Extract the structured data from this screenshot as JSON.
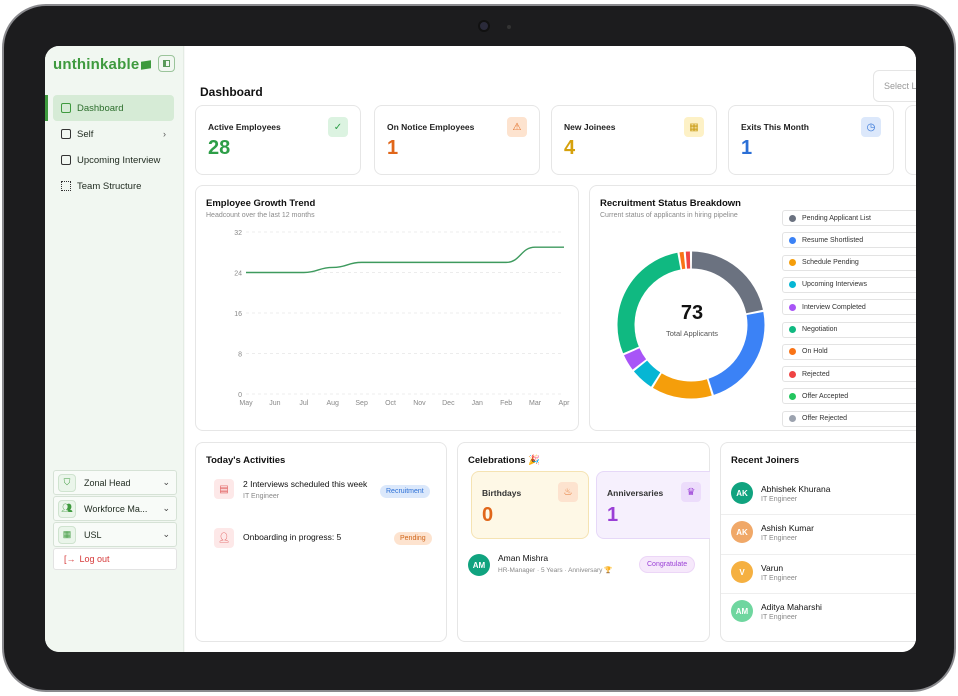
{
  "brand": {
    "name": "unthinkable"
  },
  "sidebar": {
    "items": [
      {
        "label": "Dashboard",
        "active": true
      },
      {
        "label": "Self",
        "has_children": true
      },
      {
        "label": "Upcoming Interview"
      },
      {
        "label": "Team Structure"
      }
    ],
    "selects": [
      {
        "label": "Zonal Head",
        "icon": "shield-icon"
      },
      {
        "label": "Workforce Ma...",
        "icon": "users-icon"
      },
      {
        "label": "USL",
        "icon": "building-icon"
      }
    ],
    "logout": "Log out"
  },
  "header": {
    "title": "Dashboard",
    "select_placeholder": "Select L"
  },
  "stats": [
    {
      "label": "Active Employees",
      "value": "28",
      "color": "#2e9e48",
      "icon": "check-circle-icon"
    },
    {
      "label": "On Notice Employees",
      "value": "1",
      "color": "#e0661a",
      "icon": "warning-icon"
    },
    {
      "label": "New Joinees",
      "value": "4",
      "color": "#d6a10c",
      "icon": "calendar-icon"
    },
    {
      "label": "Exits This Month",
      "value": "1",
      "color": "#2b6fd6",
      "icon": "clock-icon"
    }
  ],
  "growth": {
    "title": "Employee Growth Trend",
    "subtitle": "Headcount over the last 12 months",
    "chart_data": {
      "type": "line",
      "x": [
        "May",
        "Jun",
        "Jul",
        "Aug",
        "Sep",
        "Oct",
        "Nov",
        "Dec",
        "Jan",
        "Feb",
        "Mar",
        "Apr"
      ],
      "yticks": [
        "32",
        "24",
        "16",
        "8",
        "0"
      ],
      "values": [
        24,
        24,
        24,
        25,
        26,
        26,
        26,
        26,
        26,
        26,
        29,
        29
      ],
      "ylim": [
        0,
        32
      ],
      "color": "#3e9a5e"
    }
  },
  "recruit": {
    "title": "Recruitment Status Breakdown",
    "subtitle": "Current status of applicants in hiring pipeline",
    "total": "73",
    "total_label": "Total Applicants",
    "chart_data": {
      "type": "pie",
      "categories": [
        "Pending Applicant List",
        "Resume Shortlisted",
        "Schedule Pending",
        "Upcoming Interviews",
        "Interview Completed",
        "Negotiation",
        "On Hold",
        "Rejected",
        "Offer Accepted",
        "Offer Rejected"
      ],
      "values": [
        16,
        17,
        10,
        4,
        3,
        21,
        1,
        1,
        0,
        0
      ],
      "colors": [
        "#6b7280",
        "#3b82f6",
        "#f59e0b",
        "#06b6d4",
        "#a855f7",
        "#10b981",
        "#f97316",
        "#ef4444",
        "#22c55e",
        "#9ca3af"
      ]
    }
  },
  "activities": {
    "title": "Today's Activities",
    "items": [
      {
        "text": "2 Interviews scheduled this week",
        "sub": "IT Engineer",
        "badge": "Recruitment",
        "icon": "clipboard-icon"
      },
      {
        "text": "Onboarding in progress: 5",
        "sub": "",
        "badge": "Pending",
        "icon": "user-plus-icon"
      }
    ]
  },
  "celebrations": {
    "title": "Celebrations 🎉",
    "birthdays": {
      "label": "Birthdays",
      "value": "0",
      "icon": "cake-icon"
    },
    "anniversaries": {
      "label": "Anniversaries",
      "value": "1",
      "icon": "trophy-icon"
    },
    "person": {
      "initials": "AM",
      "name": "Aman Mishra",
      "detail": "HR-Manager · 5 Years · Anniversary 🏆",
      "button": "Congratulate"
    }
  },
  "joiners": {
    "title": "Recent Joiners",
    "items": [
      {
        "initials": "AK",
        "name": "Abhishek Khurana",
        "role": "IT Engineer",
        "color": "#10a37f"
      },
      {
        "initials": "AK",
        "name": "Ashish Kumar",
        "role": "IT Engineer",
        "color": "#f0a868"
      },
      {
        "initials": "V",
        "name": "Varun",
        "role": "IT Engineer",
        "color": "#f5b041"
      },
      {
        "initials": "AM",
        "name": "Aditya Maharshi",
        "role": "IT Engineer",
        "color": "#6fd69f"
      }
    ]
  }
}
